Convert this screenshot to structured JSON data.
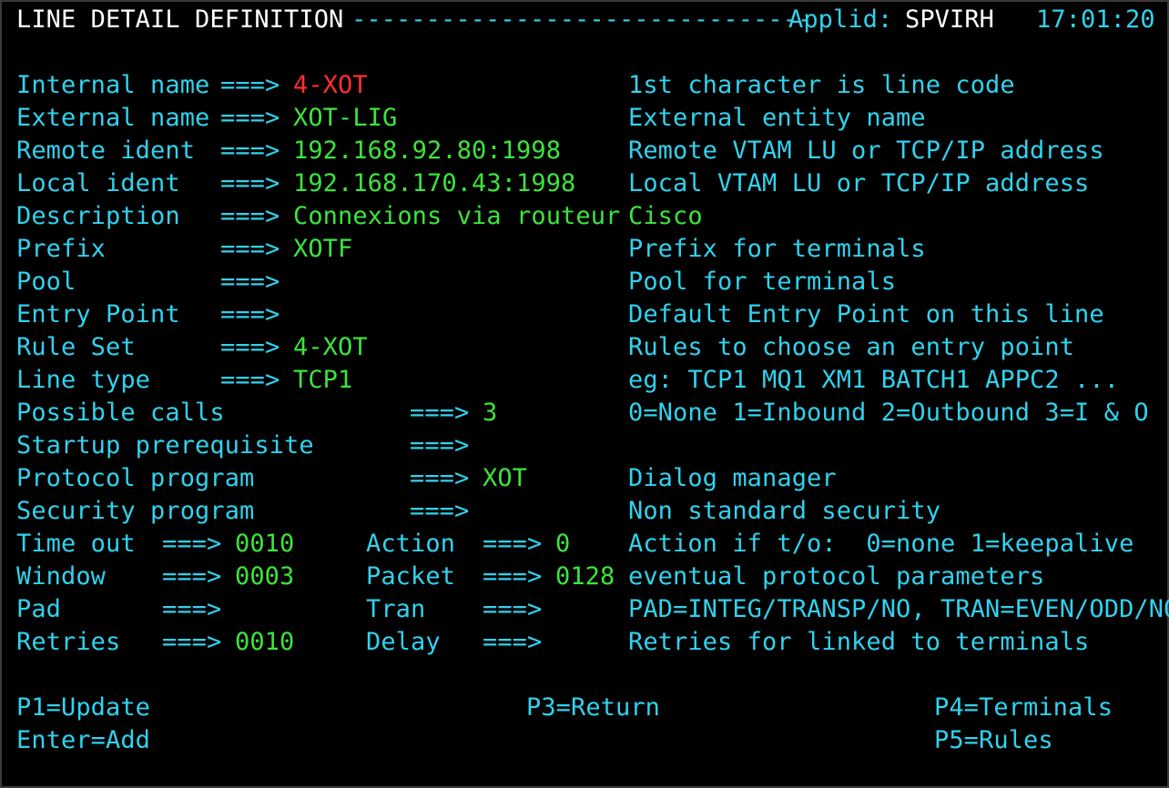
{
  "header": {
    "title": "LINE DETAIL DEFINITION",
    "dashes": "-------------------------------",
    "applid_label": "Applid:",
    "applid_value": "SPVIRH",
    "time": "17:01:20"
  },
  "fields": [
    {
      "label": "Internal name",
      "arrow": "===>",
      "value": "4-XOT",
      "help": "1st character is line code"
    },
    {
      "label": "External name",
      "arrow": "===>",
      "value": "XOT-LIG",
      "help": "External entity name"
    },
    {
      "label": "Remote ident",
      "arrow": "===>",
      "value": "192.168.92.80:1998",
      "help": "Remote VTAM LU or TCP/IP address"
    },
    {
      "label": "Local ident",
      "arrow": "===>",
      "value": "192.168.170.43:1998",
      "help": "Local VTAM LU or TCP/IP address"
    },
    {
      "label": "Description",
      "arrow": "===>",
      "value": "Connexions via routeur",
      "help": "Cisco"
    },
    {
      "label": "Prefix",
      "arrow": "===>",
      "value": "XOTF",
      "help": "Prefix for terminals"
    },
    {
      "label": "Pool",
      "arrow": "===>",
      "value": "",
      "help": "Pool for terminals"
    },
    {
      "label": "Entry Point",
      "arrow": "===>",
      "value": "",
      "help": "Default Entry Point on this line"
    },
    {
      "label": "Rule Set",
      "arrow": "===>",
      "value": "4-XOT",
      "help": "Rules to choose an entry point"
    },
    {
      "label": "Line type",
      "arrow": "===>",
      "value": "TCP1",
      "help": "eg: TCP1 MQ1 XM1 BATCH1 APPC2 ..."
    }
  ],
  "fields2": [
    {
      "label": "Possible calls",
      "arrow": "===>",
      "value": "3",
      "help": "0=None 1=Inbound 2=Outbound 3=I & O"
    },
    {
      "label": "Startup prerequisite",
      "arrow": "===>",
      "value": "",
      "help": ""
    },
    {
      "label": "Protocol program",
      "arrow": "===>",
      "value": "XOT",
      "help": "Dialog manager"
    },
    {
      "label": "Security program",
      "arrow": "===>",
      "value": "",
      "help": "Non standard security"
    }
  ],
  "fields3": [
    {
      "label1": "Time out",
      "arrow1": "===>",
      "value1": "0010",
      "label2": "Action",
      "arrow2": "===>",
      "value2": "0",
      "help": "Action if t/o:  0=none 1=keepalive"
    },
    {
      "label1": "Window",
      "arrow1": "===>",
      "value1": "0003",
      "label2": "Packet",
      "arrow2": "===>",
      "value2": "0128",
      "help": "eventual protocol parameters"
    },
    {
      "label1": "Pad",
      "arrow1": "===>",
      "value1": "",
      "label2": "Tran",
      "arrow2": "===>",
      "value2": "",
      "help": "PAD=INTEG/TRANSP/NO, TRAN=EVEN/ODD/NO"
    },
    {
      "label1": "Retries",
      "arrow1": "===>",
      "value1": "0010",
      "label2": "Delay",
      "arrow2": "===>",
      "value2": "",
      "help": "Retries for linked to terminals"
    }
  ],
  "pfkeys": {
    "p1": "P1=Update",
    "enter": "Enter=Add",
    "p3": "P3=Return",
    "p4": "P4=Terminals",
    "p5": "P5=Rules"
  },
  "colors": {
    "background": "#000000",
    "header": "#ffffff",
    "label": "#31d2ee",
    "value": "#3ce43c",
    "error_value": "#ff3030"
  }
}
